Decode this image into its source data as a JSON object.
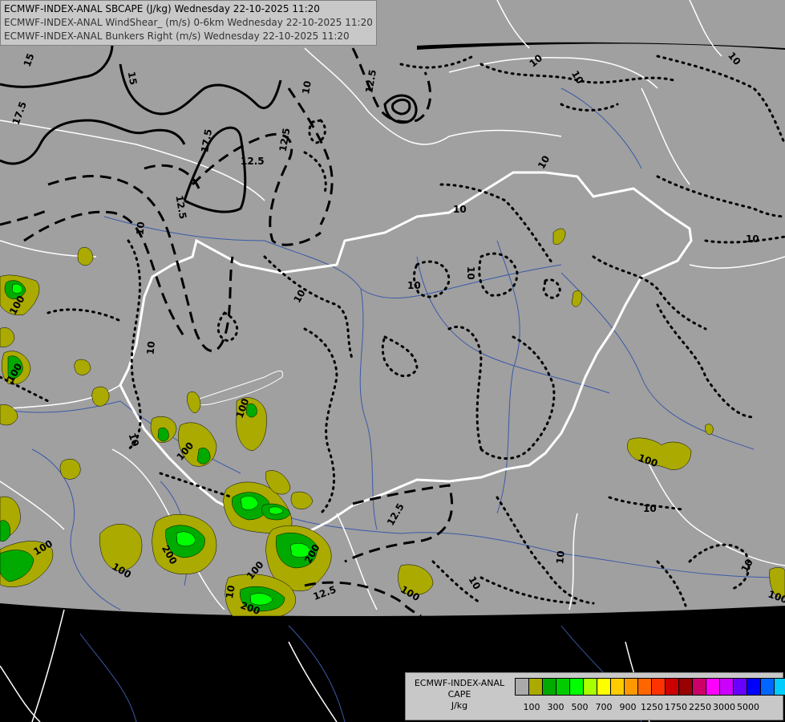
{
  "title": {
    "line1": "ECMWF-INDEX-ANAL SBCAPE (J/kg) Wednesday 22-10-2025 11:20",
    "line2": "ECMWF-INDEX-ANAL WindShear_ (m/s) 0-6km Wednesday 22-10-2025 11:20",
    "line3": "ECMWF-INDEX-ANAL Bunkers Right (m/s) Wednesday 22-10-2025 11:20"
  },
  "legend": {
    "line1": "ECMWF-INDEX-ANAL",
    "line2": "CAPE",
    "line3": "J/kg",
    "colors": [
      "#aaaaaa",
      "#aaaa00",
      "#00aa00",
      "#00cc00",
      "#00ff00",
      "#aaff00",
      "#ffff00",
      "#ffcc00",
      "#ff9900",
      "#ff6600",
      "#ff3300",
      "#cc0000",
      "#990000",
      "#cc0066",
      "#ff00ff",
      "#cc00ff",
      "#6600ff",
      "#0000ff",
      "#0066ff",
      "#00ccff",
      "#66ffff",
      "#ffffff"
    ],
    "labels": [
      "100",
      "300",
      "500",
      "700",
      "900",
      "1250",
      "1750",
      "2250",
      "3000",
      "5000"
    ]
  },
  "map_labels": {
    "shear_12_5": "12.5",
    "shear_15": "15",
    "shear_17_5": "17.5",
    "bunkers_10": "10",
    "cape_100": "100",
    "cape_200": "200"
  },
  "colors": {
    "background": "#000000",
    "domain": "#a0a0a0",
    "cape_100": "#aaaa00",
    "cape_200": "#00aa00",
    "cape_300": "#00ff00",
    "border_hu": "#ffffff"
  }
}
